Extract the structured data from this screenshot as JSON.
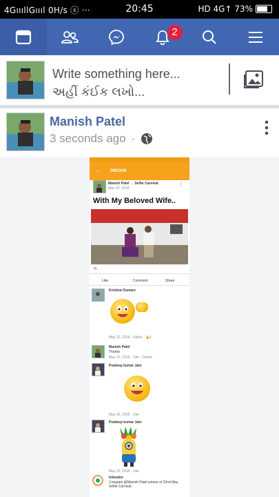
{
  "status_bar": {
    "left": "4GıııllGıııl 0H/s ⓢ ···",
    "time": "20:45",
    "right": "HD 4G↑ 73%"
  },
  "nav": {
    "tabs": [
      {
        "icon": "news-feed-icon",
        "active": true
      },
      {
        "icon": "friends-icon",
        "active": false
      },
      {
        "icon": "messenger-icon",
        "active": false
      },
      {
        "icon": "notifications-bell-icon",
        "active": false,
        "badge": "2"
      },
      {
        "icon": "search-icon",
        "active": false
      },
      {
        "icon": "menu-icon",
        "active": false
      }
    ],
    "bar_color": "#4267b2"
  },
  "composer": {
    "line1": "Write something here...",
    "line2": "અહીં કંઈક લખો..."
  },
  "post": {
    "author": "Manish Patel",
    "time": "3 seconds ago",
    "privacy_icon": "globe-icon"
  },
  "shared_screenshot": {
    "title": "INBOOK",
    "poster": "Manish Patel → Selfie Carnival",
    "date": "May 22, 2018",
    "caption": "With My Beloved Wife..",
    "reactions": "76",
    "actions": [
      "Like",
      "Comment",
      "Share"
    ],
    "comments": [
      {
        "name": "Krishna Oumare",
        "time": "May 22, 2018 · Unlike · 👍1"
      },
      {
        "name": "Manish Patel",
        "text": "Thanks",
        "time": "May 22, 2018 · Like · Delete"
      },
      {
        "name": "Pradeep kumar Jain",
        "time": "May 22, 2018 · Like"
      },
      {
        "name": "Pradeep kumar Jain",
        "time": "May 22, 2018 · Like"
      },
      {
        "name": "Inbooker",
        "text": "Congrats @Manish Patel winner of 22nd May Selfie Carnival."
      }
    ]
  }
}
